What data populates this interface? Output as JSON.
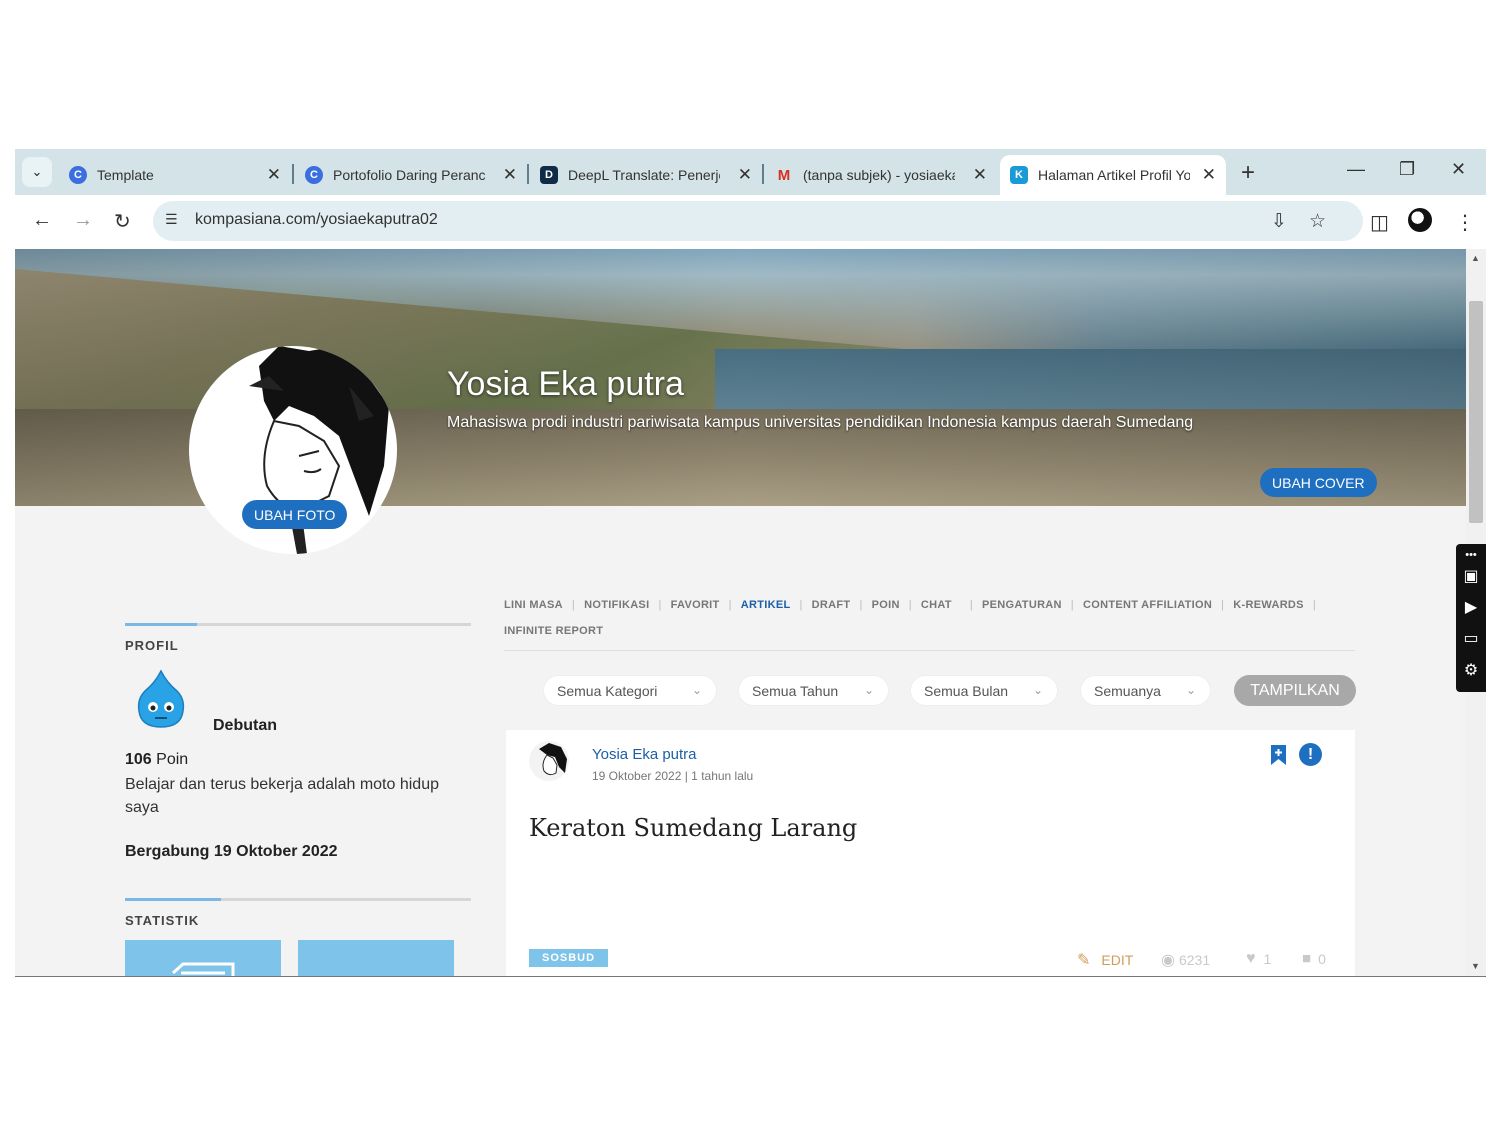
{
  "browser": {
    "tabs": [
      {
        "title": "Template",
        "favicon": "canva-icon",
        "color": "#3b6fe0"
      },
      {
        "title": "Portofolio Daring Peranc",
        "favicon": "canva-icon",
        "color": "#3b6fe0"
      },
      {
        "title": "DeepL Translate: Penerje",
        "favicon": "deepl-icon",
        "color": "#0f2b46"
      },
      {
        "title": "(tanpa subjek) - yosiaeka",
        "favicon": "gmail-icon",
        "color": "#d93025"
      },
      {
        "title": "Halaman Artikel Profil Yo",
        "favicon": "kompasiana-icon",
        "color": "#1a9bd7",
        "active": true
      }
    ],
    "url": "kompasiana.com/yosiaekaputra02"
  },
  "profile": {
    "name": "Yosia Eka putra",
    "tagline": "Mahasiswa prodi industri pariwisata kampus universitas pendidikan Indonesia kampus daerah Sumedang",
    "change_cover_label": "UBAH COVER",
    "change_photo_label": "UBAH FOTO"
  },
  "sidebar": {
    "profile_title": "PROFIL",
    "badge": "Debutan",
    "points_value": "106",
    "points_label": "Poin",
    "bio": "Belajar dan terus bekerja adalah moto hidup saya",
    "joined": "Bergabung 19 Oktober 2022",
    "stats_title": "STATISTIK"
  },
  "menu": {
    "row1": [
      "LINI MASA",
      "NOTIFIKASI",
      "FAVORIT",
      "ARTIKEL",
      "DRAFT",
      "POIN",
      "CHAT",
      "PENGATURAN",
      "CONTENT AFFILIATION",
      "K-REWARDS"
    ],
    "row2": [
      "INFINITE REPORT"
    ],
    "active": "ARTIKEL"
  },
  "filters": {
    "category": "Semua Kategori",
    "year": "Semua Tahun",
    "month": "Semua Bulan",
    "type": "Semuanya",
    "show_label": "TAMPILKAN"
  },
  "article": {
    "author": "Yosia Eka putra",
    "meta": "19 Oktober 2022 | 1 tahun lalu",
    "title": "Keraton Sumedang Larang",
    "category": "SOSBUD",
    "edit_label": "EDIT",
    "views": "6231",
    "likes": "1",
    "comments": "0"
  },
  "colors": {
    "accent": "#1e6fc0",
    "link": "#1d5fa7",
    "category_bg": "#7ec4ea",
    "edit": "#d29b5a"
  }
}
